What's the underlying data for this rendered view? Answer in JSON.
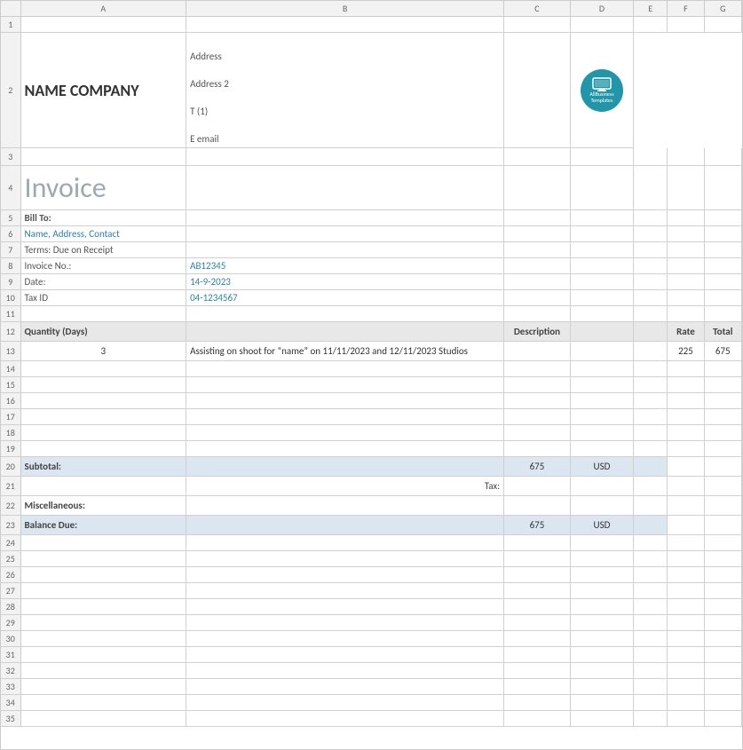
{
  "header": {
    "col_headers": [
      "",
      "A",
      "B",
      "C",
      "D",
      "E",
      "F",
      "G"
    ]
  },
  "company": {
    "name": "NAME COMPANY",
    "address1": "Address",
    "address2": "Address 2",
    "phone": "T (1)",
    "email": "E email"
  },
  "invoice": {
    "title": "Invoice",
    "bill_to_label": "Bill To:",
    "bill_to_value": "Name, Address, Contact",
    "terms_label": "Terms: Due on Receipt",
    "invoice_no_label": "Invoice No.:",
    "invoice_no_value": "AB12345",
    "date_label": "Date:",
    "date_value": "14-9-2023",
    "tax_id_label": "Tax ID",
    "tax_id_value": "04-1234567"
  },
  "table": {
    "col1_header": "Quantity (Days)",
    "col2_header": "Description",
    "col3_header": "Rate",
    "col4_header": "Total",
    "rows": [
      {
        "quantity": "3",
        "description": "Assisting on shoot for “name” on 11/11/2023 and 12/11/2023 Studios",
        "rate": "225",
        "total": "675"
      }
    ]
  },
  "summary": {
    "subtotal_label": "Subtotal:",
    "subtotal_value": "675",
    "subtotal_currency": "USD",
    "tax_label": "Tax:",
    "misc_label": "Miscellaneous:",
    "balance_label": "Balance Due:",
    "balance_value": "675",
    "balance_currency": "USD"
  },
  "logo": {
    "line1": "AllBusiness",
    "line2": "Templates"
  },
  "row_numbers": [
    "1",
    "2",
    "3",
    "4",
    "5",
    "6",
    "7",
    "8",
    "9",
    "10",
    "11",
    "12",
    "13",
    "14",
    "15",
    "16",
    "17",
    "18",
    "19",
    "20",
    "21",
    "22",
    "23",
    "24",
    "25",
    "26",
    "27",
    "28",
    "29",
    "30",
    "31",
    "32",
    "33",
    "34",
    "35"
  ]
}
